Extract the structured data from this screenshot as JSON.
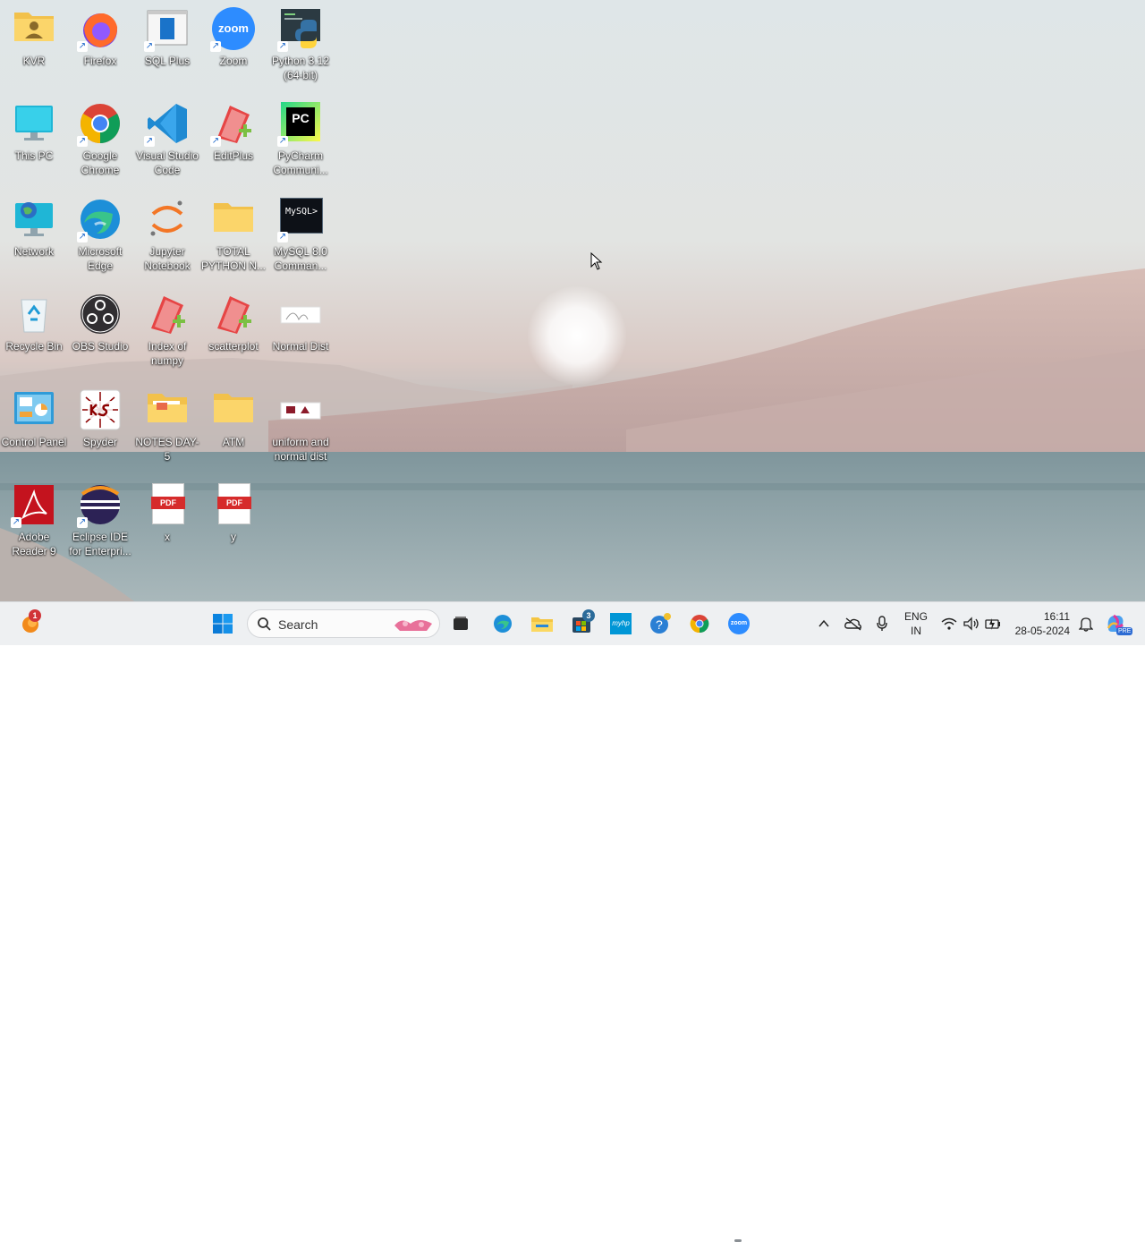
{
  "desktop": {
    "icons": [
      {
        "label": "KVR"
      },
      {
        "label": "Firefox"
      },
      {
        "label": "SQL Plus"
      },
      {
        "label": "Zoom"
      },
      {
        "label": "Python 3.12 (64-bit)"
      },
      {
        "label": "This PC"
      },
      {
        "label": "Google Chrome"
      },
      {
        "label": "Visual Studio Code"
      },
      {
        "label": "EditPlus"
      },
      {
        "label": "PyCharm Communi..."
      },
      {
        "label": "Network"
      },
      {
        "label": "Microsoft Edge"
      },
      {
        "label": "Jupyter Notebook"
      },
      {
        "label": "TOTAL PYTHON N..."
      },
      {
        "label": "MySQL 8.0 Comman..."
      },
      {
        "label": "Recycle Bin"
      },
      {
        "label": "OBS Studio"
      },
      {
        "label": "Index of numpy"
      },
      {
        "label": "scatterplot"
      },
      {
        "label": "Normal Dist"
      },
      {
        "label": "Control Panel"
      },
      {
        "label": "Spyder"
      },
      {
        "label": "NOTES DAY-5"
      },
      {
        "label": "ATM"
      },
      {
        "label": "uniform and normal dist"
      },
      {
        "label": "Adobe Reader 9"
      },
      {
        "label": "Eclipse IDE for Enterpri..."
      },
      {
        "label": "x"
      },
      {
        "label": "y"
      }
    ],
    "icon_glyphs": {
      "zoom": "zoom",
      "pdf": "PDF",
      "pycharm": "PC",
      "mysql": "MySQL>"
    }
  },
  "taskbar": {
    "search_placeholder": "Search",
    "weather_badge": "1",
    "store_badge": "3",
    "myhp_label": "myhp",
    "zoom_label": "zoom",
    "lang_primary": "ENG",
    "lang_secondary": "IN",
    "time": "16:11",
    "date": "28-05-2024",
    "copilot_badge": "PRE"
  },
  "colors": {
    "taskbar_bg": "#eef0f2",
    "accent_blue": "#0078d4",
    "zoom_blue": "#2d8cff"
  }
}
